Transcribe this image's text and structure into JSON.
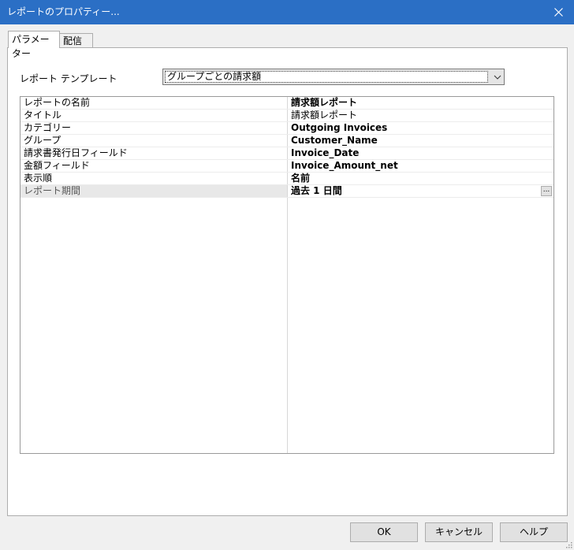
{
  "window": {
    "title": "レポートのプロパティー..."
  },
  "tabs": [
    {
      "label": "パラメーター",
      "active": true
    },
    {
      "label": "配信",
      "active": false
    }
  ],
  "template": {
    "label": "レポート テンプレート",
    "value": "グループごとの請求額"
  },
  "properties": [
    {
      "name": "レポートの名前",
      "value": "請求額レポート",
      "bold": true
    },
    {
      "name": "タイトル",
      "value": "請求額レポート",
      "bold": false
    },
    {
      "name": "カテゴリー",
      "value": "Outgoing Invoices",
      "bold": true
    },
    {
      "name": "グループ",
      "value": "Customer_Name",
      "bold": true
    },
    {
      "name": "請求書発行日フィールド",
      "value": "Invoice_Date",
      "bold": true
    },
    {
      "name": "金額フィールド",
      "value": "Invoice_Amount_net",
      "bold": true
    },
    {
      "name": "表示順",
      "value": "名前",
      "bold": true
    },
    {
      "name": "レポート期間",
      "value": "過去 1 日間",
      "bold": true,
      "selected": true,
      "button": "..."
    }
  ],
  "buttons": {
    "ok": "OK",
    "cancel": "キャンセル",
    "help": "ヘルプ"
  },
  "colors": {
    "titlebar": "#2b6fc5",
    "background": "#f0f0f0"
  }
}
